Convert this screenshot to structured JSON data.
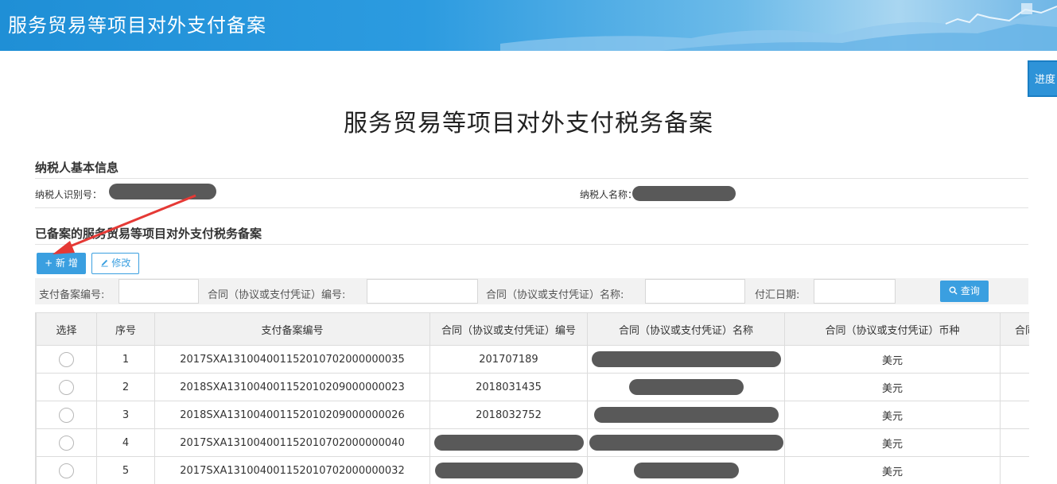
{
  "header": {
    "title": "服务贸易等项目对外支付备案"
  },
  "progress_tab": {
    "label": "进度"
  },
  "page_title": "服务贸易等项目对外支付税务备案",
  "taxpayer": {
    "section_title": "纳税人基本信息",
    "id_label": "纳税人识别号：",
    "name_label": "纳税人名称："
  },
  "records": {
    "section_title": "已备案的服务贸易等项目对外支付税务备案",
    "add_label": "+ 新 增",
    "edit_label": "修改"
  },
  "filters": {
    "payment_no_label": "支付备案编号:",
    "contract_no_label": "合同（协议或支付凭证）编号:",
    "contract_name_label": "合同（协议或支付凭证）名称:",
    "date_label": "付汇日期:",
    "query_label": "查询"
  },
  "table": {
    "headers": [
      "选择",
      "序号",
      "支付备案编号",
      "合同（协议或支付凭证）编号",
      "合同（协议或支付凭证）名称",
      "合同（协议或支付凭证）币种",
      "合同"
    ],
    "rows": [
      {
        "seq": "1",
        "payment_no": "2017SXA131004001152010702000000035",
        "contract_no": "201707189",
        "currency": "美元"
      },
      {
        "seq": "2",
        "payment_no": "2018SXA131004001152010209000000023",
        "contract_no": "2018031435",
        "currency": "美元"
      },
      {
        "seq": "3",
        "payment_no": "2018SXA131004001152010209000000026",
        "contract_no": "2018032752",
        "currency": "美元"
      },
      {
        "seq": "4",
        "payment_no": "2017SXA131004001152010702000000040",
        "contract_no": "",
        "currency": "美元"
      },
      {
        "seq": "5",
        "payment_no": "2017SXA131004001152010702000000032",
        "contract_no": "",
        "currency": "美元"
      }
    ]
  },
  "colors": {
    "header_blue": "#1f8fd6",
    "button_blue": "#3a9fe0",
    "annotation_red": "#e53935"
  }
}
